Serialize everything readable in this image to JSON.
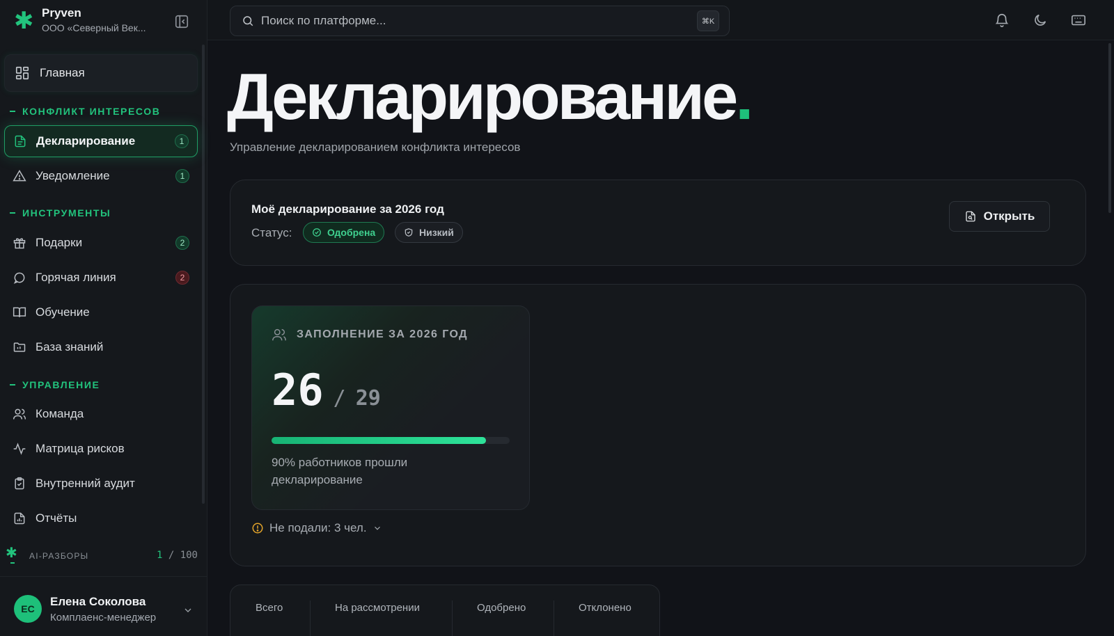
{
  "brand": {
    "name": "Pryven",
    "org": "ООО «Северный Век..."
  },
  "search": {
    "placeholder": "Поиск по платформе...",
    "shortcut": "⌘K"
  },
  "nav": {
    "home": "Главная",
    "sections": [
      {
        "title": "КОНФЛИКТ ИНТЕРЕСОВ"
      },
      {
        "title": "ИНСТРУМЕНТЫ"
      },
      {
        "title": "УПРАВЛЕНИЕ"
      }
    ],
    "items": [
      {
        "label": "Декларирование",
        "badge": "1",
        "icon": "file-text-icon"
      },
      {
        "label": "Уведомление",
        "badge": "1",
        "icon": "alert-triangle-icon"
      },
      {
        "label": "Подарки",
        "badge": "2",
        "icon": "gift-icon"
      },
      {
        "label": "Горячая линия",
        "badge": "2",
        "icon": "message-circle-icon"
      },
      {
        "label": "Обучение",
        "icon": "book-open-icon"
      },
      {
        "label": "База знаний",
        "icon": "folder-icon"
      },
      {
        "label": "Команда",
        "icon": "users-icon"
      },
      {
        "label": "Матрица рисков",
        "icon": "activity-icon"
      },
      {
        "label": "Внутренний аудит",
        "icon": "clipboard-icon"
      },
      {
        "label": "Отчёты",
        "icon": "file-chart-icon"
      }
    ]
  },
  "ai": {
    "label": "AI-РАЗБОРЫ",
    "used": "1",
    "limit": "100"
  },
  "user": {
    "initials": "ЕС",
    "name": "Елена Соколова",
    "role": "Комплаенс-менеджер"
  },
  "page": {
    "title": "Декларирование",
    "title_dot": ".",
    "subtitle": "Управление декларированием конфликта интересов"
  },
  "declaration": {
    "title": "Моё декларирование за 2026 год",
    "status_label": "Статус:",
    "status": "Одобрена",
    "risk": "Низкий",
    "open_button": "Открыть"
  },
  "filling": {
    "title": "ЗАПОЛНЕНИЕ ЗА 2026 ГОД",
    "done": "26",
    "separator": "/",
    "total": "29",
    "progress": 0.9,
    "description": "90% работников прошли декларирование",
    "not_filed": "Не подали: 3 чел."
  },
  "stats": {
    "labels": [
      "Всего",
      "На рассмотрении",
      "Одобрено",
      "Отклонено"
    ]
  },
  "colors": {
    "accent": "#22c37d",
    "warning": "#e3a42a",
    "danger": "#e0525c"
  }
}
